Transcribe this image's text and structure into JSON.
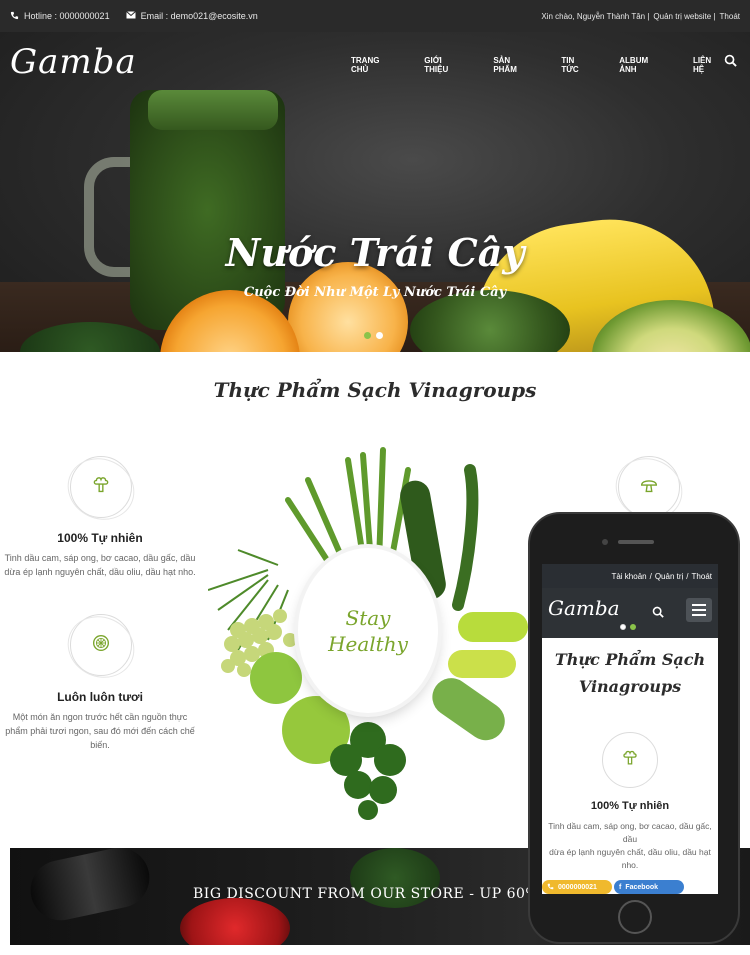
{
  "topbar": {
    "hotline_icon": "phone-icon",
    "hotline": "Hotline : 0000000021",
    "email_icon": "envelope-icon",
    "email": "Email : demo021@ecosite.vn",
    "greeting": "Xin chào, Nguyễn Thành Tân |",
    "admin": "Quản trị website |",
    "logout": "Thoát"
  },
  "nav": {
    "logo": "Gamba",
    "menu": [
      "TRANG CHỦ",
      "GIỚI THIỆU",
      "SẢN PHẨM",
      "TIN TỨC",
      "ALBUM ẢNH",
      "LIÊN HỆ"
    ],
    "search_icon": "search-icon"
  },
  "hero": {
    "title": "Nước Trái Cây",
    "subtitle": "Cuộc Đời Như Một Ly Nước Trái Cây",
    "dots_active": 1
  },
  "section": {
    "title": "Thực Phẩm Sạch Vinagroups"
  },
  "features": [
    {
      "icon": "broccoli-icon",
      "title": "100% Tự nhiên",
      "text_lines": [
        "Tinh dầu cam, sáp ong, bơ cacao, dầu gấc, dầu",
        "dừa ép lạnh nguyên chất, dầu oliu, dầu hạt nho."
      ]
    },
    {
      "icon": "lime-icon",
      "title": "Luôn luôn tươi",
      "text_lines": [
        "Một món ăn ngon trước hết cần nguồn thực",
        "phẩm phải tươi ngon, sau đó mới đến cách chế",
        "biến."
      ]
    },
    {
      "icon": "mushroom-icon"
    }
  ],
  "plate": {
    "line1": "Stay",
    "line2": "Healthy"
  },
  "phone": {
    "top_links": [
      "Tài khoản",
      "/",
      "Quản trị",
      "/",
      "Thoát"
    ],
    "logo": "Gamba",
    "title_line1": "Thực Phẩm Sạch",
    "title_line2": "Vinagroups",
    "feature_icon": "broccoli-icon",
    "feature_title": "100% Tự nhiên",
    "feature_text_lines": [
      "Tinh dầu cam, sáp ong, bơ cacao, dầu gấc, dầu",
      "dừa ép lạnh nguyên chất, dầu oliu, dầu hạt",
      "nho."
    ],
    "hotline": "0000000021",
    "facebook": "Facebook"
  },
  "discount": {
    "text": "BIG DISCOUNT FROM OUR STORE - UP 60% O"
  },
  "colors": {
    "accent_green": "#7aa52c",
    "dot_green": "#8bc34a",
    "dot_white": "#ffffff",
    "hotline_yellow": "#f0b92d",
    "facebook_blue": "#3b7fd0"
  }
}
